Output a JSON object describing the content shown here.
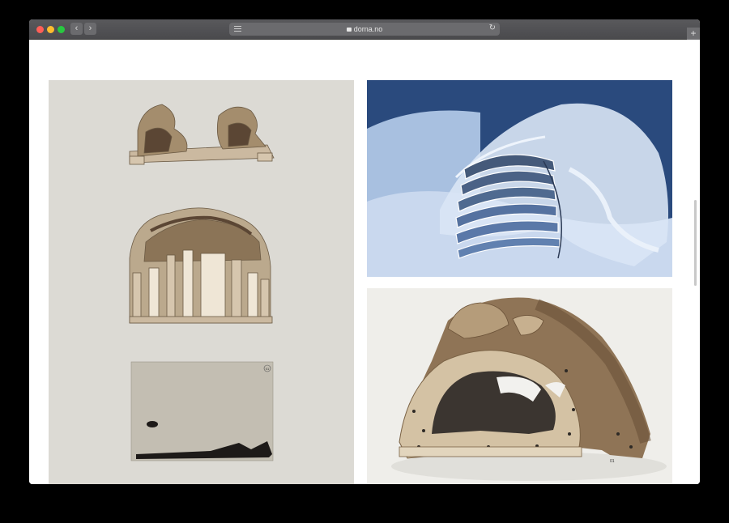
{
  "browser": {
    "url": "dorna.no",
    "nav_back_icon": "chevron-left-icon",
    "nav_forward_icon": "chevron-right-icon",
    "reload_icon": "reload-icon",
    "new_tab_icon": "plus-icon"
  },
  "gallery": {
    "images": [
      {
        "id": "left-panel",
        "description_icon": "sculpture-sections-image"
      },
      {
        "id": "ice-photo",
        "description_icon": "ice-sculpture-image"
      },
      {
        "id": "model-photo",
        "description_icon": "laser-cut-model-image"
      }
    ],
    "sheet_number": "01",
    "model_number": "01"
  },
  "colors": {
    "panel_bg": "#dcdad4",
    "titlebar": "#4f4f52",
    "page_bg": "#ffffff"
  }
}
